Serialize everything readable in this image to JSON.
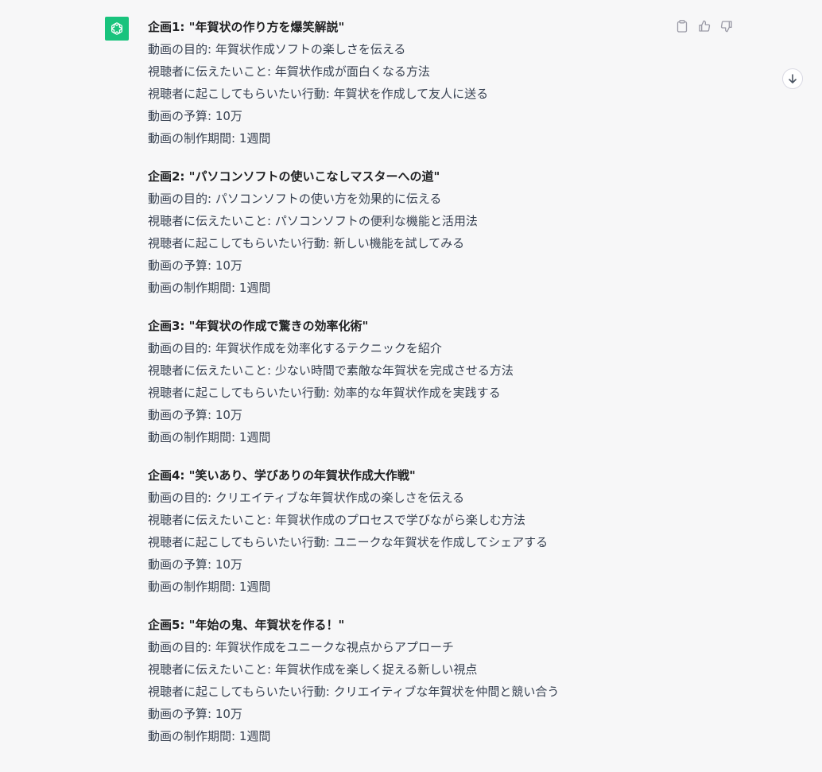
{
  "assistant": {
    "avatar_icon": "openai-logo-icon",
    "avatar_color": "#19c37d"
  },
  "actions": {
    "copy_icon": "clipboard-icon",
    "like_icon": "thumbs-up-icon",
    "dislike_icon": "thumbs-down-icon"
  },
  "scroll": {
    "icon": "arrow-down-icon"
  },
  "plans": [
    {
      "title": "企画1: \"年賀状の作り方を爆笑解説\"",
      "lines": [
        "動画の目的: 年賀状作成ソフトの楽しさを伝える",
        "視聴者に伝えたいこと: 年賀状作成が面白くなる方法",
        "視聴者に起こしてもらいたい行動: 年賀状を作成して友人に送る",
        "動画の予算: 10万",
        "動画の制作期間: 1週間"
      ]
    },
    {
      "title": "企画2: \"パソコンソフトの使いこなしマスターへの道\"",
      "lines": [
        "動画の目的: パソコンソフトの使い方を効果的に伝える",
        "視聴者に伝えたいこと: パソコンソフトの便利な機能と活用法",
        "視聴者に起こしてもらいたい行動: 新しい機能を試してみる",
        "動画の予算: 10万",
        "動画の制作期間: 1週間"
      ]
    },
    {
      "title": "企画3: \"年賀状の作成で驚きの効率化術\"",
      "lines": [
        "動画の目的: 年賀状作成を効率化するテクニックを紹介",
        "視聴者に伝えたいこと: 少ない時間で素敵な年賀状を完成させる方法",
        "視聴者に起こしてもらいたい行動: 効率的な年賀状作成を実践する",
        "動画の予算: 10万",
        "動画の制作期間: 1週間"
      ]
    },
    {
      "title": "企画4: \"笑いあり、学びありの年賀状作成大作戦\"",
      "lines": [
        "動画の目的: クリエイティブな年賀状作成の楽しさを伝える",
        "視聴者に伝えたいこと: 年賀状作成のプロセスで学びながら楽しむ方法",
        "視聴者に起こしてもらいたい行動: ユニークな年賀状を作成してシェアする",
        "動画の予算: 10万",
        "動画の制作期間: 1週間"
      ]
    },
    {
      "title": "企画5: \"年始の鬼、年賀状を作る！\"",
      "lines": [
        "動画の目的: 年賀状作成をユニークな視点からアプローチ",
        "視聴者に伝えたいこと: 年賀状作成を楽しく捉える新しい視点",
        "視聴者に起こしてもらいたい行動: クリエイティブな年賀状を仲間と競い合う",
        "動画の予算: 10万",
        "動画の制作期間: 1週間"
      ]
    }
  ]
}
